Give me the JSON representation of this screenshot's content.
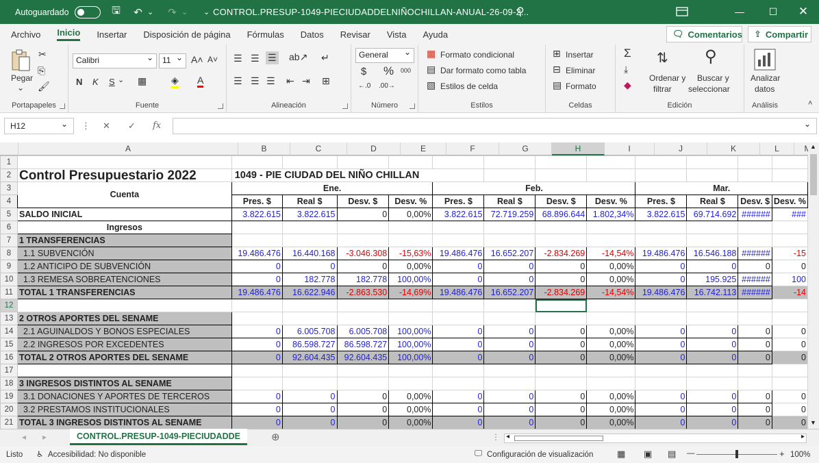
{
  "titlebar": {
    "autosave_label": "Autoguardado",
    "doc_title": "CONTROL.PRESUP-1049-PIECIUDADDELNIÑOCHILLAN-ANUAL-26-09-2...",
    "accent": "#217346"
  },
  "menu": {
    "items": [
      "Archivo",
      "Inicio",
      "Insertar",
      "Disposición de página",
      "Fórmulas",
      "Datos",
      "Revisar",
      "Vista",
      "Ayuda"
    ],
    "comments_label": "Comentarios",
    "share_label": "Compartir"
  },
  "ribbon": {
    "clipboard": {
      "paste": "Pegar",
      "label": "Portapapeles"
    },
    "font": {
      "family": "Calibri",
      "size": "11",
      "label": "Fuente",
      "bold": "N",
      "italic": "K",
      "underline": "S"
    },
    "alignment": {
      "label": "Alineación"
    },
    "number": {
      "format": "General",
      "label": "Número",
      "currency": "$",
      "percent": "%",
      "thousands": "000"
    },
    "styles": {
      "cond_format": "Formato condicional",
      "table_format": "Dar formato como tabla",
      "cell_styles": "Estilos de celda",
      "label": "Estilos"
    },
    "cells": {
      "insert": "Insertar",
      "delete": "Eliminar",
      "format": "Formato",
      "label": "Celdas"
    },
    "editing": {
      "sort1": "Ordenar y",
      "sort2": "filtrar",
      "find1": "Buscar y",
      "find2": "seleccionar",
      "label": "Edición"
    },
    "analysis": {
      "analyze1": "Analizar",
      "analyze2": "datos",
      "label": "Análisis"
    }
  },
  "formula_bar": {
    "name_box": "H12",
    "formula": ""
  },
  "columns": [
    "A",
    "B",
    "C",
    "D",
    "E",
    "F",
    "G",
    "H",
    "I",
    "J",
    "K",
    "L",
    "M"
  ],
  "selected_column": "H",
  "selected_row": 12,
  "sheet": {
    "title": "Control Presupuestario 2022",
    "subtitle": "1049 - PIE CIUDAD DEL NIÑO CHILLAN",
    "account_header": "Cuenta",
    "months": [
      "Ene.",
      "Feb.",
      "Mar."
    ],
    "sub_headers": [
      "Pres. $",
      "Real $",
      "Desv. $",
      "Desv. %"
    ],
    "rows": {
      "r5": [
        "SALDO INICIAL",
        "3.822.615",
        "3.822.615",
        "0",
        "0,00%",
        "3.822.615",
        "72.719.259",
        "68.896.644",
        "1.802,34%",
        "3.822.615",
        "69.714.692",
        "######",
        "###"
      ],
      "r6": [
        "Ingresos"
      ],
      "r7": [
        "1 TRANSFERENCIAS"
      ],
      "r8": [
        "1.1 SUBVENCIÓN",
        "19.486.476",
        "16.440.168",
        "-3.046.308",
        "-15,63%",
        "19.486.476",
        "16.652.207",
        "-2.834.269",
        "-14,54%",
        "19.486.476",
        "16.546.188",
        "######",
        "-15"
      ],
      "r9": [
        "1.2 ANTICIPO DE SUBVENCIÓN",
        "0",
        "0",
        "0",
        "0,00%",
        "0",
        "0",
        "0",
        "0,00%",
        "0",
        "0",
        "0",
        "0"
      ],
      "r10": [
        "1.3 REMESA SOBREATENCIONES",
        "0",
        "182.778",
        "182.778",
        "100,00%",
        "0",
        "0",
        "0",
        "0,00%",
        "0",
        "195.925",
        "######",
        "100"
      ],
      "r11": [
        "TOTAL 1 TRANSFERENCIAS",
        "19.486.476",
        "16.622.946",
        "-2.863.530",
        "-14,69%",
        "19.486.476",
        "16.652.207",
        "-2.834.269",
        "-14,54%",
        "19.486.476",
        "16.742.113",
        "######",
        "-14"
      ],
      "r13": [
        "2 OTROS APORTES DEL SENAME"
      ],
      "r14": [
        "2.1 AGUINALDOS Y BONOS ESPECIALES",
        "0",
        "6.005.708",
        "6.005.708",
        "100,00%",
        "0",
        "0",
        "0",
        "0,00%",
        "0",
        "0",
        "0",
        "0"
      ],
      "r15": [
        "2.2 INGRESOS POR EXCEDENTES",
        "0",
        "86.598.727",
        "86.598.727",
        "100,00%",
        "0",
        "0",
        "0",
        "0,00%",
        "0",
        "0",
        "0",
        "0"
      ],
      "r16": [
        "TOTAL 2 OTROS APORTES DEL SENAME",
        "0",
        "92.604.435",
        "92.604.435",
        "100,00%",
        "0",
        "0",
        "0",
        "0,00%",
        "0",
        "0",
        "0",
        "0"
      ],
      "r18": [
        "3 INGRESOS DISTINTOS AL SENAME"
      ],
      "r19": [
        "3.1 DONACIONES Y APORTES DE TERCEROS",
        "0",
        "0",
        "0",
        "0,00%",
        "0",
        "0",
        "0",
        "0,00%",
        "0",
        "0",
        "0",
        "0"
      ],
      "r20": [
        "3.2 PRESTAMOS INSTITUCIONALES",
        "0",
        "0",
        "0",
        "0,00%",
        "0",
        "0",
        "0",
        "0,00%",
        "0",
        "0",
        "0",
        "0"
      ],
      "r21": [
        "TOTAL 3 INGRESOS DISTINTOS AL SENAME",
        "0",
        "0",
        "0",
        "0,00%",
        "0",
        "0",
        "0",
        "0,00%",
        "0",
        "0",
        "0",
        "0"
      ]
    }
  },
  "sheet_tab": "CONTROL.PRESUP-1049-PIECIUDADDE",
  "status": {
    "ready": "Listo",
    "accessibility": "Accesibilidad: No disponible",
    "display_settings": "Configuración de visualización",
    "zoom": "100%"
  }
}
